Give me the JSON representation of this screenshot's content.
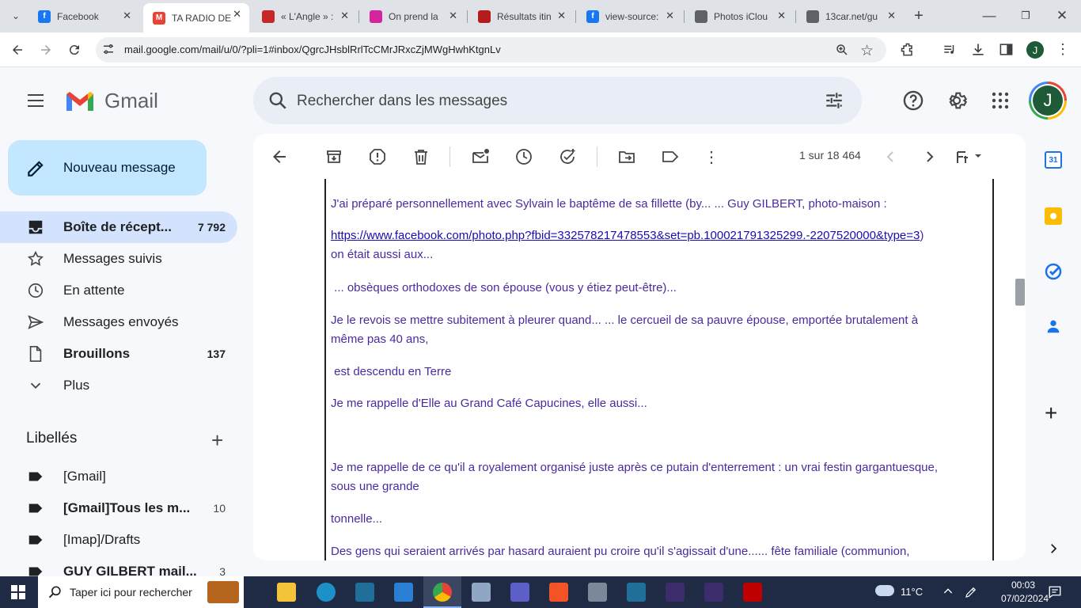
{
  "browser": {
    "tabs": [
      {
        "title": "Facebook",
        "icon": "facebook-icon",
        "color": "#1877f2"
      },
      {
        "title": "TA RADIO DE",
        "icon": "gmail-icon",
        "color": "#ea4335",
        "active": true
      },
      {
        "title": "« L'Angle » :",
        "icon": "site-icon",
        "color": "#c62828"
      },
      {
        "title": "On prend la",
        "icon": "instagram-icon",
        "color": "#d6249f"
      },
      {
        "title": "Résultats itin",
        "icon": "train-icon",
        "color": "#b71c1c"
      },
      {
        "title": "view-source:",
        "icon": "facebook-icon",
        "color": "#1877f2"
      },
      {
        "title": "Photos iClou",
        "icon": "apple-icon",
        "color": "#5f6368"
      },
      {
        "title": "13car.net/gu",
        "icon": "globe-icon",
        "color": "#5f6368"
      }
    ],
    "url": "mail.google.com/mail/u/0/?pli=1#inbox/QgrcJHsblRrlTcCMrJRxcZjMWgHwhKtgnLv",
    "profile_letter": "J"
  },
  "gmail": {
    "logo_text": "Gmail",
    "search_placeholder": "Rechercher dans les messages",
    "compose_label": "Nouveau message",
    "nav": [
      {
        "label": "Boîte de récept...",
        "count": "7 792",
        "icon": "inbox-icon",
        "bold": true,
        "selected": true
      },
      {
        "label": "Messages suivis",
        "count": "",
        "icon": "star-icon"
      },
      {
        "label": "En attente",
        "count": "",
        "icon": "clock-icon"
      },
      {
        "label": "Messages envoyés",
        "count": "",
        "icon": "send-icon"
      },
      {
        "label": "Brouillons",
        "count": "137",
        "icon": "draft-icon",
        "bold": true
      },
      {
        "label": "Plus",
        "count": "",
        "icon": "chevron-down-icon"
      }
    ],
    "labels_title": "Libellés",
    "labels": [
      {
        "label": "[Gmail]",
        "count": ""
      },
      {
        "label": "[Gmail]Tous les m...",
        "count": "10",
        "bold": true
      },
      {
        "label": "[Imap]/Drafts",
        "count": ""
      },
      {
        "label": "GUY GILBERT mail...",
        "count": "3",
        "bold": true
      }
    ],
    "pager": "1 sur 18 464",
    "avatar_letter": "J"
  },
  "mail": {
    "lines": [
      {
        "text": "J'ai préparé personnellement avec Sylvain le baptême de sa fillette (by... ... Guy GILBERT, photo-maison :"
      },
      {
        "link": "https://www.facebook.com/photo.php?fbid=332578217478553&set=pb.100021791325299.-2207520000&type=3",
        "after": ")",
        "text2": "on était aussi aux..."
      },
      {
        "text": " ... obsèques orthodoxes de son épouse (vous y étiez peut-être)..."
      },
      {
        "text": "Je le revois se mettre subitement à pleurer quand... ... le cercueil de sa pauvre épouse, emportée brutalement à",
        "text2": "même pas 40 ans,"
      },
      {
        "text": " est descendu en Terre"
      },
      {
        "text": "Je me rappelle d'Elle au Grand Café Capucines, elle aussi..."
      },
      {
        "text": "Je me rappelle de ce qu'il a royalement organisé juste après ce putain d'enterrement : un vrai festin gargantuesque,",
        "text2": "sous une grande"
      },
      {
        "text": "tonnelle..."
      },
      {
        "text": "Des gens qui seraient arrivés par hasard auraient pu croire qu'il s'agissait d'une...... fête familiale (communion,"
      }
    ]
  },
  "taskbar": {
    "search_placeholder": "Taper ici pour rechercher",
    "weather": "11°C",
    "time": "00:03",
    "date": "07/02/2024"
  }
}
